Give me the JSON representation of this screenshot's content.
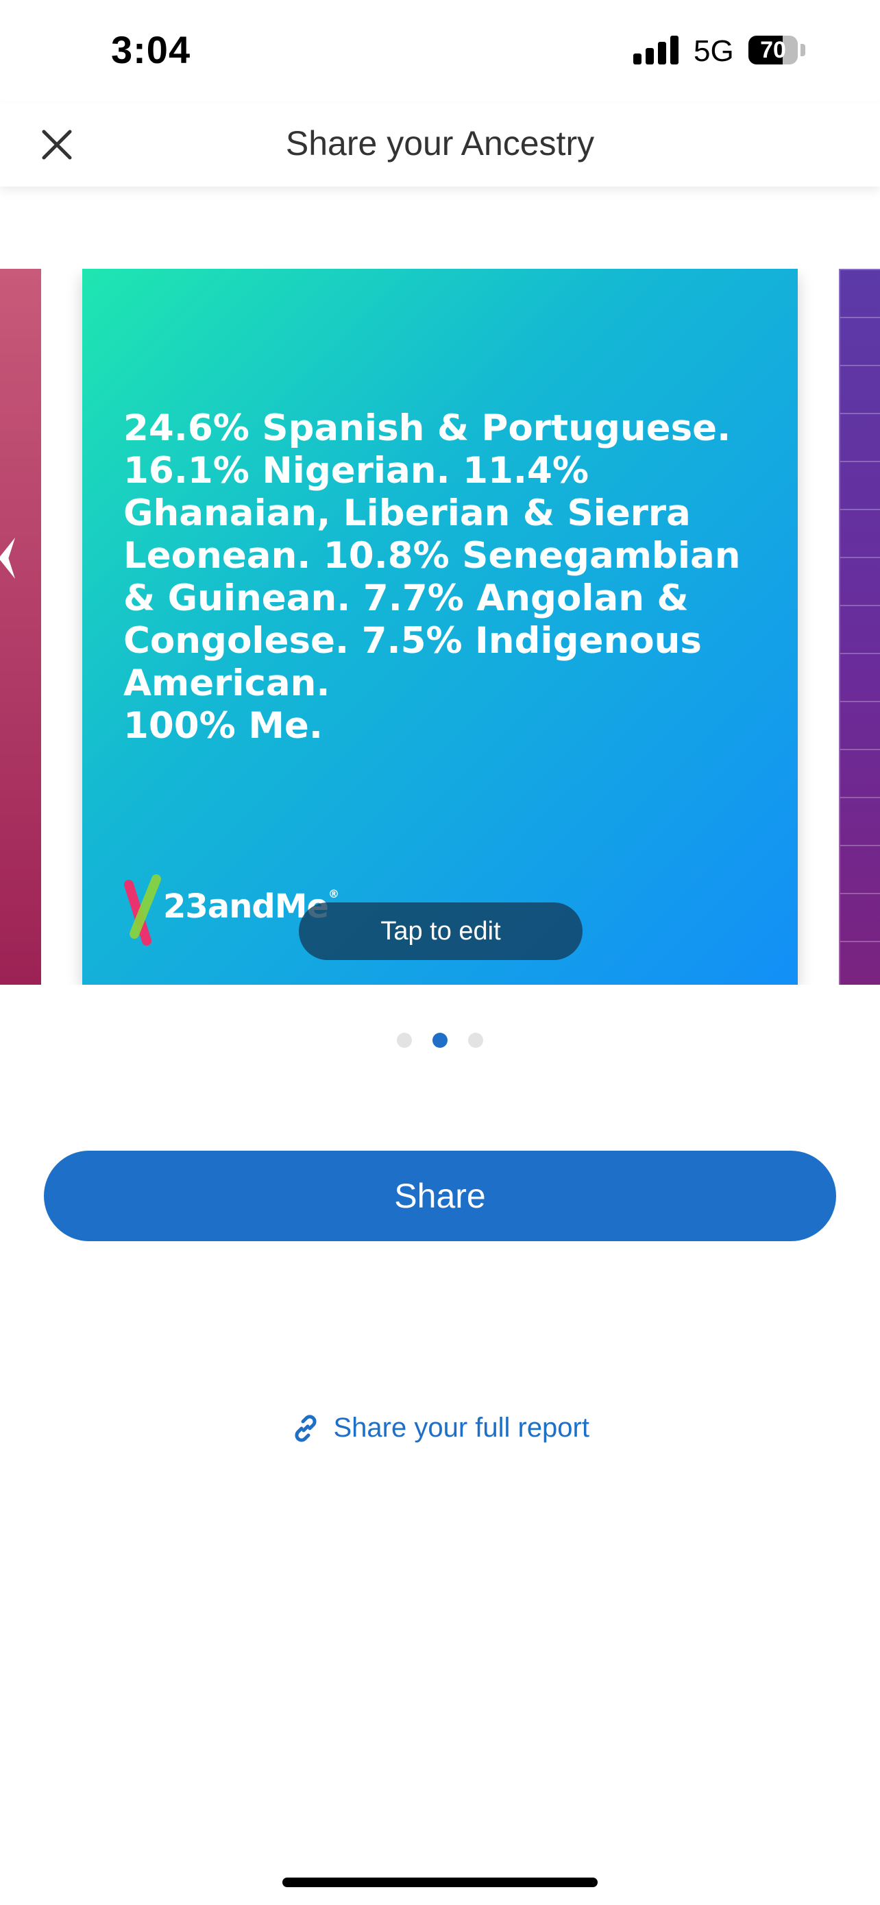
{
  "status_bar": {
    "time": "3:04",
    "network": "5G",
    "battery_level": "70",
    "battery_fraction": 0.7
  },
  "header": {
    "title": "Share your Ancestry",
    "close_icon": "close-icon"
  },
  "carousel": {
    "current_card": {
      "text": "24.6% Spanish & Portuguese.\n16.1% Nigerian.  11.4%\nGhanaian, Liberian & Sierra\nLeonean.  10.8% Senegambian\n& Guinean.  7.7% Angolan &\nCongolese.  7.5% Indigenous\nAmerican.\n100% Me.",
      "brand_name": "23andMe",
      "brand_reg": "®",
      "tap_to_edit_label": "Tap to edit",
      "colors": {
        "gradient_start": "#1fe6b0",
        "gradient_end": "#138ff7"
      }
    },
    "total_cards": 3,
    "active_index": 1
  },
  "actions": {
    "share_label": "Share",
    "full_report_label": "Share your full report",
    "link_icon": "link-icon"
  },
  "colors": {
    "accent": "#1e6fc8",
    "dot_inactive": "#e3e3e3"
  }
}
